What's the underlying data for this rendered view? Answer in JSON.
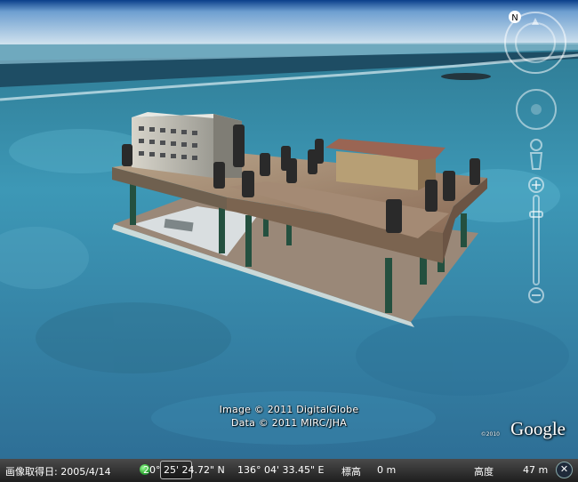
{
  "credits": {
    "line1": "Image © 2011 DigitalGlobe",
    "line2": "Data © 2011 MIRC/JHA"
  },
  "logo": {
    "text": "Google",
    "sub": "©2010"
  },
  "statusbar": {
    "imagery_date_label": "画像取得日: 2005/4/14",
    "latitude": "20° 25' 24.72\" N",
    "longitude": "136° 04' 33.45\" E",
    "elevation_label": "標高",
    "elevation_value": "0 m",
    "eye_alt_label": "高度",
    "eye_alt_value": "47 m"
  },
  "controls": {
    "compass_icon": "north-compass-icon",
    "look_icon": "look-joystick-icon",
    "move_icon": "move-joystick-icon",
    "pegman_icon": "street-view-pegman-icon",
    "zoom_icon": "zoom-slider-icon",
    "close_icon": "close-icon"
  },
  "colors": {
    "sky": "#cfe3f3",
    "sea": "#3c93b4",
    "roof": "#9a6553",
    "status_bg": "#2a2a2a"
  }
}
